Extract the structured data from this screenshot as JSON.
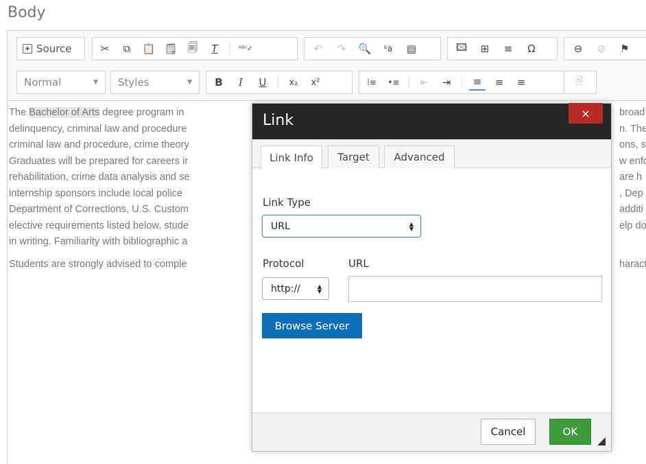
{
  "field_label": "Body",
  "toolbar": {
    "source_label": "Source",
    "format_value": "Normal",
    "styles_value": "Styles"
  },
  "content": {
    "paragraph1": [
      {
        "pre": "The ",
        "hl": "Bachelor of Arts",
        "post": " degree program in"
      },
      {
        "pre": "delinquency, criminal law and procedure"
      },
      {
        "pre": "criminal law and procedure, crime theory"
      },
      {
        "pre": "Graduates will be prepared for careers ir"
      },
      {
        "pre": "rehabilitation, crime data analysis and se"
      },
      {
        "pre": "internship sponsors include local police"
      },
      {
        "pre": "Department of Corrections, U.S. Custom"
      },
      {
        "pre": "elective requirements listed below, stude"
      },
      {
        "pre": "in writing. Familiarity with bibliographic a"
      }
    ],
    "right_fragments1": [
      "broad",
      "n. The",
      "ons, st",
      "w enfo",
      "are h",
      ", Dep",
      "additi",
      "elp do"
    ],
    "paragraph2_left": "Students are strongly advised to comple",
    "paragraph2_right": "haract"
  },
  "dialog": {
    "title": "Link",
    "close_glyph": "×",
    "tabs": [
      "Link Info",
      "Target",
      "Advanced"
    ],
    "link_type_label": "Link Type",
    "link_type_value": "URL",
    "protocol_label": "Protocol",
    "protocol_value": "http://",
    "url_label": "URL",
    "url_value": "",
    "browse_label": "Browse Server",
    "cancel_label": "Cancel",
    "ok_label": "OK"
  },
  "colors": {
    "ok_green": "#3e9b3a",
    "browse_blue": "#0e6eb8",
    "close_red": "#b92b27",
    "title_bar": "#262626"
  }
}
